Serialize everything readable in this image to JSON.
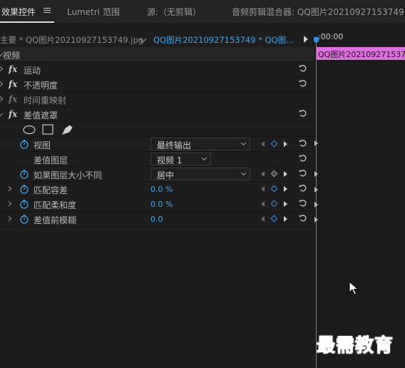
{
  "tabs": [
    {
      "label": "效果控件",
      "active": true
    },
    {
      "label": "Lumetri 范围",
      "active": false
    },
    {
      "label": "源:（无剪辑）",
      "active": false
    },
    {
      "label": "音频剪辑混合器: QQ图片20210927153749",
      "active": false
    }
  ],
  "clip_header": {
    "master_label": "主要 * QQ图片20210927153749.jpg",
    "sequence_label": "QQ图片20210927153749 * QQ图..."
  },
  "timeline": {
    "ruler_label": ":00:00",
    "clip_label": "QQ图片20210927153749"
  },
  "sections": {
    "video": "视频",
    "motion": "运动",
    "opacity": "不透明度",
    "time_remap": "时间重映射",
    "difference_matte": "差值遮罩"
  },
  "fx_label": "fx",
  "properties": {
    "view": {
      "label": "视图",
      "value": "最终输出"
    },
    "difference_layer": {
      "label": "差值图层",
      "value": "视频 1"
    },
    "if_layer_sizes_differ": {
      "label": "如果图层大小不同",
      "value": "居中"
    },
    "match_tolerance": {
      "label": "匹配容差",
      "value": "0.0 %"
    },
    "match_softness": {
      "label": "匹配柔和度",
      "value": "0.0 %"
    },
    "blur_before_difference": {
      "label": "差值前模糊",
      "value": "0.0"
    }
  },
  "watermark": "最需教育",
  "icons": {
    "menu": "hamburger-menu-icon",
    "reset": "reset-icon",
    "stopwatch": "stopwatch-icon",
    "ellipse_mask": "ellipse-mask-icon",
    "rect_mask": "rectangle-mask-icon",
    "pen_mask": "pen-mask-icon"
  },
  "colors": {
    "accent_blue": "#3ea6f0",
    "clip_pink": "#e06ee0",
    "watermark_blue": "#2a5fd6"
  }
}
